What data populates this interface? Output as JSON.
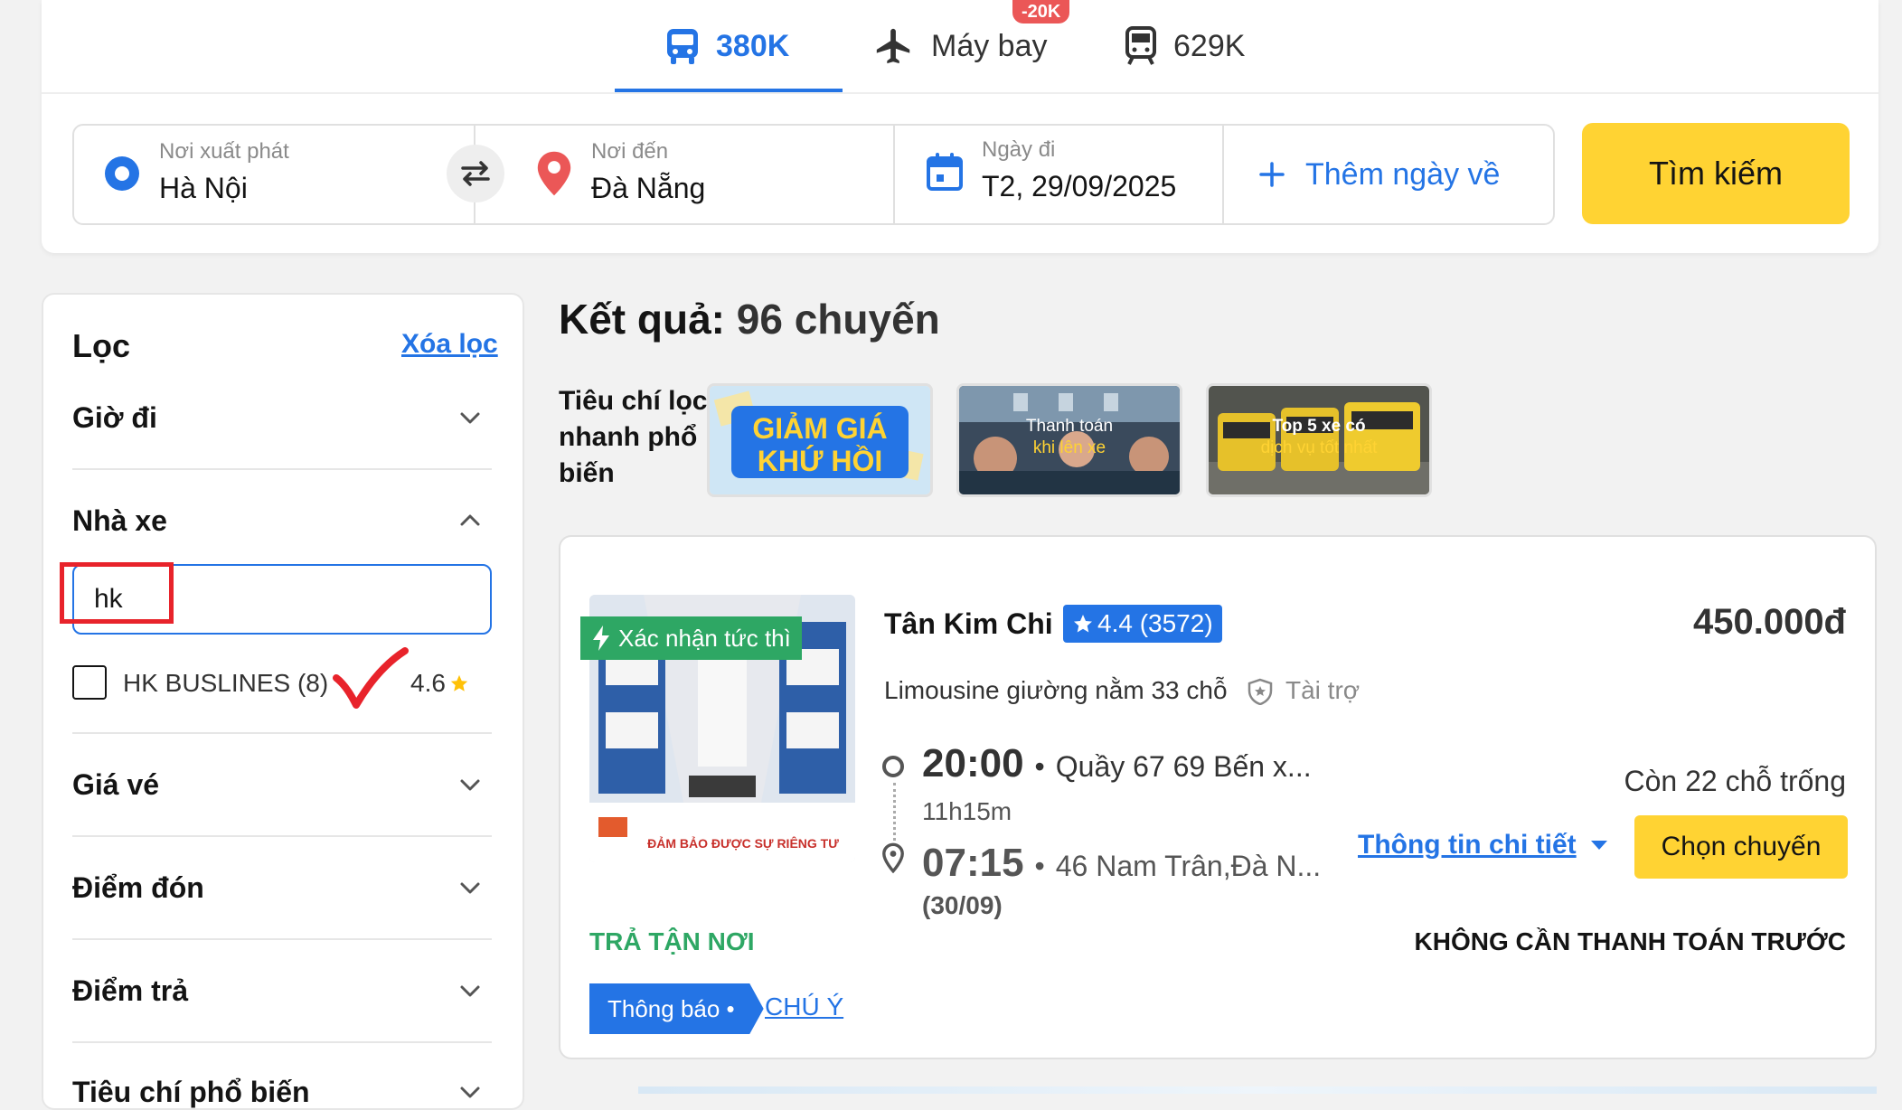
{
  "tabs": [
    {
      "label": "380K",
      "icon": "bus-icon",
      "active": true
    },
    {
      "label": "Máy bay",
      "icon": "airplane-icon",
      "badge": "-20K"
    },
    {
      "label": "629K",
      "icon": "train-icon"
    }
  ],
  "search": {
    "from_label": "Nơi xuất phát",
    "from_value": "Hà Nội",
    "to_label": "Nơi đến",
    "to_value": "Đà Nẵng",
    "date_label": "Ngày đi",
    "date_value": "T2, 29/09/2025",
    "add_return": "Thêm ngày về",
    "search_button": "Tìm kiếm"
  },
  "filter": {
    "title": "Lọc",
    "clear": "Xóa lọc",
    "sections": {
      "departure_time": "Giờ đi",
      "operator": "Nhà xe",
      "price": "Giá vé",
      "pickup": "Điểm đón",
      "dropoff": "Điểm trả",
      "popular": "Tiêu chí phổ biến"
    },
    "operator_search_value": "hk",
    "operator_option": {
      "label": "HK BUSLINES (8)",
      "rating": "4.6",
      "checked": false
    }
  },
  "results": {
    "title_prefix": "Kết quả:",
    "title_count": "96 chuyến",
    "quick_filter_label": "Tiêu chí lọc nhanh phổ biến",
    "quick_filters": [
      {
        "line1": "GIẢM GIÁ",
        "line2": "KHỨ HỒI"
      },
      {
        "line1": "Thanh toán",
        "line2": "khi lên xe"
      },
      {
        "line1": "Top 5 xe có",
        "line2": "dịch vụ tốt nhất"
      }
    ]
  },
  "trip": {
    "instant_confirm": "Xác nhận tức thì",
    "image_caption": "ĐẢM BẢO ĐƯỢC SỰ RIÊNG TƯ",
    "operator": "Tân Kim Chi",
    "rating": "4.4 (3572)",
    "price": "450.000đ",
    "bus_type": "Limousine giường nằm 33 chỗ",
    "sponsored": "Tài trợ",
    "depart_time": "20:00",
    "depart_place": "Quầy 67 69 Bến x...",
    "duration": "11h15m",
    "arrive_time": "07:15",
    "arrive_place": "46 Nam Trân,Đà N...",
    "arrive_date": "(30/09)",
    "seats_left": "Còn 22 chỗ trống",
    "details_link": "Thông tin chi tiết",
    "choose_button": "Chọn chuyến",
    "door_dropoff": "TRẢ TẬN NƠI",
    "no_prepay": "KHÔNG CẦN THANH TOÁN TRƯỚC",
    "notice_tag": "Thông báo •",
    "notice_link": "CHÚ Ý"
  },
  "colors": {
    "accent": "#2474e5",
    "cta": "#ffd333",
    "green": "#2ea764",
    "red": "#e8232b"
  }
}
